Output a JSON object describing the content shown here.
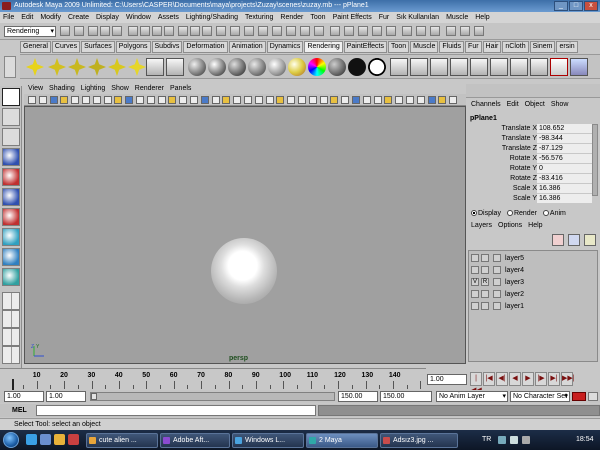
{
  "window": {
    "title": "Autodesk Maya 2009 Unlimited: C:\\Users\\CASPER\\Documents\\maya\\projects\\Zuzay\\scenes\\zuzay.mb    ---    pPlane1",
    "minimize": "_",
    "maximize": "□",
    "close": "x"
  },
  "menubar": [
    "File",
    "Edit",
    "Modify",
    "Create",
    "Display",
    "Window",
    "Assets",
    "Lighting/Shading",
    "Texturing",
    "Render",
    "Toon",
    "Paint Effects",
    "Fur",
    "Sık Kullanılan",
    "Muscle",
    "Help"
  ],
  "statusline": {
    "mode": "Rendering"
  },
  "shelf": {
    "tabs": [
      "General",
      "Curves",
      "Surfaces",
      "Polygons",
      "Subdivs",
      "Deformation",
      "Animation",
      "Dynamics",
      "Rendering",
      "PaintEffects",
      "Toon",
      "Muscle",
      "Fluids",
      "Fur",
      "Hair",
      "nCloth",
      "Sinem",
      "ersin"
    ],
    "active_tab": "Rendering"
  },
  "panel": {
    "menu": [
      "View",
      "Shading",
      "Lighting",
      "Show",
      "Renderer",
      "Panels"
    ],
    "camera": "persp",
    "axis_y": "Y",
    "axis_z": "Z"
  },
  "channel_box": {
    "menu": [
      "Channels",
      "Edit",
      "Object",
      "Show"
    ],
    "object": "pPlane1",
    "attributes": [
      {
        "name": "Translate X",
        "value": "108.652"
      },
      {
        "name": "Translate Y",
        "value": "-98.344"
      },
      {
        "name": "Translate Z",
        "value": "-87.129"
      },
      {
        "name": "Rotate X",
        "value": "-56.576"
      },
      {
        "name": "Rotate Y",
        "value": "0"
      },
      {
        "name": "Rotate Z",
        "value": "-83.416"
      },
      {
        "name": "Scale X",
        "value": "16.386"
      },
      {
        "name": "Scale Y",
        "value": "16.386"
      }
    ]
  },
  "layer_editor": {
    "modes": [
      "Display",
      "Render",
      "Anim"
    ],
    "active_mode": "Display",
    "menu": [
      "Layers",
      "Options",
      "Help"
    ],
    "layers": [
      {
        "name": "layer5",
        "v": "",
        "r": ""
      },
      {
        "name": "layer4",
        "v": "",
        "r": ""
      },
      {
        "name": "layer3",
        "v": "V",
        "r": "R"
      },
      {
        "name": "layer2",
        "v": "",
        "r": ""
      },
      {
        "name": "layer1",
        "v": "",
        "r": ""
      }
    ]
  },
  "timeline": {
    "ticks": [
      "10",
      "20",
      "30",
      "40",
      "50",
      "60",
      "70",
      "80",
      "90",
      "100",
      "110",
      "120",
      "130",
      "140"
    ],
    "current_time": "1.00",
    "play_buttons": [
      "|◀◀",
      "|◀",
      "◀|",
      "◀",
      "▶",
      "|▶",
      "▶|",
      "▶▶|"
    ]
  },
  "range": {
    "start": "1.00",
    "playback_start": "1.00",
    "playback_end": "150.00",
    "end": "150.00",
    "anim_layer": "No Anim Layer",
    "character_set": "No Character Set"
  },
  "mel": {
    "label": "MEL"
  },
  "help_line": "Select Tool: select an object",
  "taskbar": {
    "tasks": [
      {
        "label": "cute alien ...",
        "color": "#e8a53a"
      },
      {
        "label": "Adobe Aft...",
        "color": "#8b4bd1"
      },
      {
        "label": "Windows L...",
        "color": "#4aa3df"
      },
      {
        "label": "2 Maya",
        "color": "#2fa8a8"
      },
      {
        "label": "Adsız3.jpg ...",
        "color": "#c94c4c"
      }
    ],
    "lang": "TR",
    "clock": "18:54"
  },
  "colors": {
    "viewport": "#a0a0a0",
    "accent": "#8a1d1d",
    "title": "#3d6fa8"
  }
}
